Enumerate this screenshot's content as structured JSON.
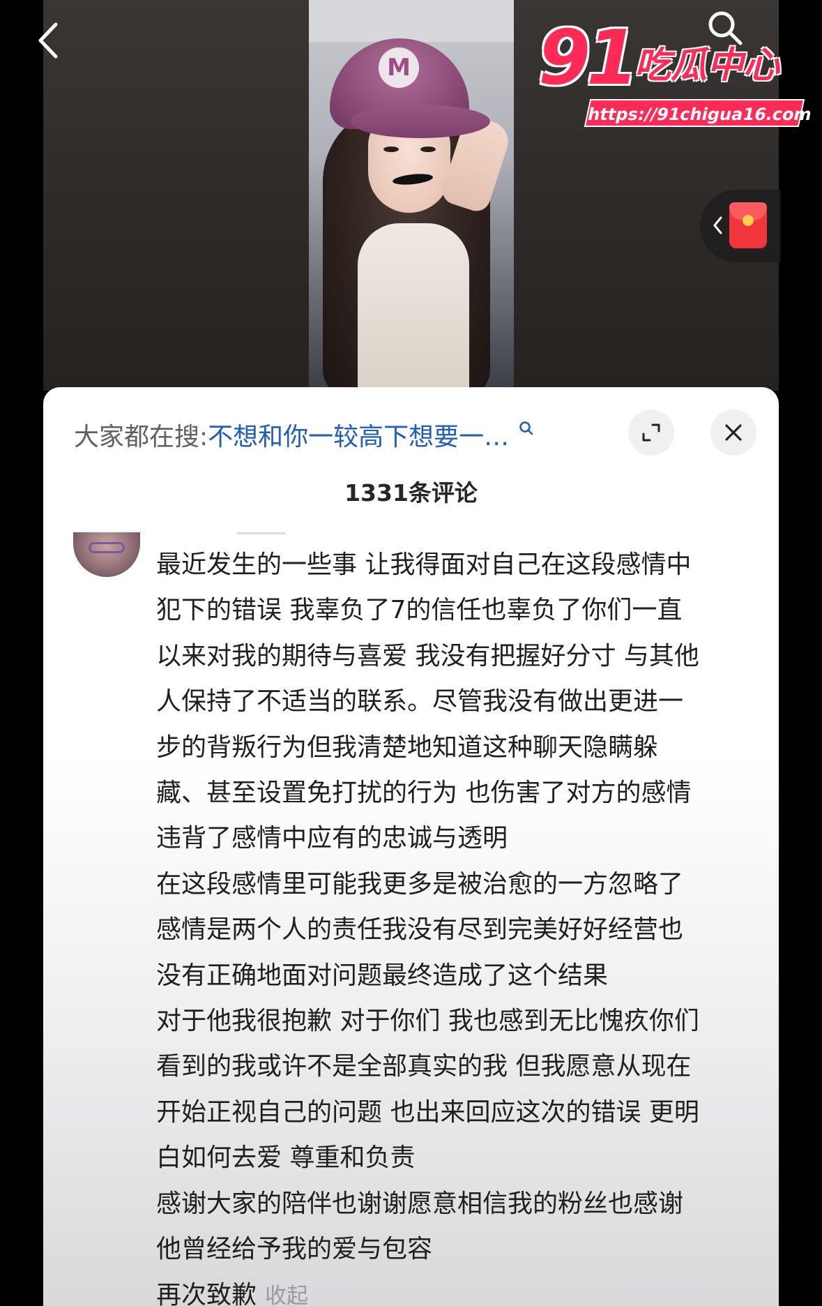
{
  "video": {
    "cap_letter": "M"
  },
  "watermark": {
    "number": "91",
    "title": "吃瓜中心",
    "url": "https://91chigua16.com"
  },
  "icons": {
    "back": "chevron-left-icon",
    "search": "search-icon",
    "red_packet": "red-packet-icon",
    "expand": "expand-icon",
    "close": "close-icon"
  },
  "sheet": {
    "search_prefix": "大家都在搜:",
    "search_query": "不想和你一较高下想要一…",
    "comment_count": "1331条评论"
  },
  "comment": {
    "lines": [
      "最近发生的一些事 让我得面对自己在这段感情中",
      "犯下的错误 我辜负了7的信任也辜负了你们一直",
      "以来对我的期待与喜爱 我没有把握好分寸 与其他",
      "人保持了不适当的联系。尽管我没有做出更进一",
      "步的背叛行为但我清楚地知道这种聊天隐瞒躲",
      "藏、甚至设置免打扰的行为 也伤害了对方的感情",
      "违背了感情中应有的忠诚与透明",
      "在这段感情里可能我更多是被治愈的一方忽略了",
      "感情是两个人的责任我没有尽到完美好好经营也",
      "没有正确地面对问题最终造成了这个结果",
      "对于他我很抱歉 对于你们 我也感到无比愧疚你们",
      "看到的我或许不是全部真实的我  但我愿意从现在",
      "开始正视自己的问题 也出来回应这次的错误 更明",
      "白如何去爱 尊重和负责",
      "感谢大家的陪伴也谢谢愿意相信我的粉丝也感谢",
      "他曾经给予我的爱与包容",
      "再次致歉"
    ],
    "collapse_label": "收起"
  },
  "colors": {
    "accent_blue": "#1f5fb8",
    "watermark_red": "#ff2a55",
    "packet_red": "#f0363c"
  }
}
